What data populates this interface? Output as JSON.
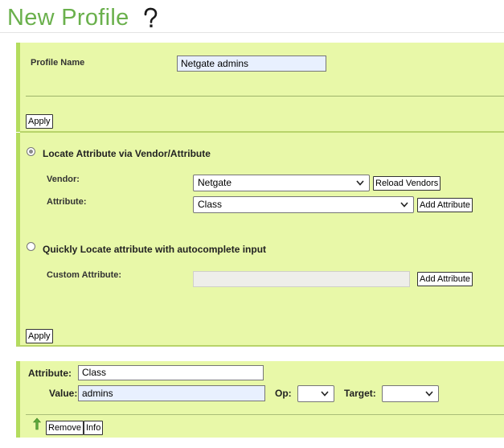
{
  "page": {
    "title": "New Profile",
    "help_icon": "question-mark-icon"
  },
  "profile": {
    "name_label": "Profile Name",
    "name_value": "Netgate admins",
    "apply_label": "Apply"
  },
  "locate": {
    "vendor_attr_option_label": "Locate Attribute via Vendor/Attribute",
    "vendor_attr_selected": true,
    "vendor_label": "Vendor:",
    "vendor_value": "Netgate",
    "reload_vendors_label": "Reload Vendors",
    "attribute_label": "Attribute:",
    "attribute_value": "Class",
    "add_attribute_label": "Add Attribute",
    "autocomplete_option_label": "Quickly Locate attribute with autocomplete input",
    "custom_attribute_label": "Custom Attribute:",
    "custom_attribute_value": "",
    "add_custom_attribute_label": "Add Attribute",
    "apply_label": "Apply"
  },
  "entry": {
    "attribute_label": "Attribute:",
    "attribute_value": "Class",
    "value_label": "Value:",
    "value_value": "admins",
    "op_label": "Op:",
    "op_value": "",
    "target_label": "Target:",
    "target_value": "",
    "move_icon": "green-up-arrow-icon",
    "remove_label": "Remove",
    "info_label": "Info"
  },
  "colors": {
    "title_green": "#6ab04c",
    "panel_bg": "#e8f8a8",
    "panel_border": "#b4dc5e"
  }
}
